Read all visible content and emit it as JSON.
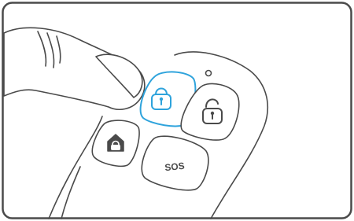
{
  "illustration": {
    "frame_color": "#4a4a4a",
    "line_color": "#4a4a4a",
    "highlight_color": "#2ea3dc",
    "buttons": [
      {
        "name": "lock-button",
        "icon": "lock-closed-icon",
        "pressed": true
      },
      {
        "name": "unlock-button",
        "icon": "lock-open-icon",
        "pressed": false
      },
      {
        "name": "home-arm-button",
        "icon": "home-lock-icon",
        "pressed": false
      },
      {
        "name": "sos-button",
        "label": "SOS",
        "pressed": false
      }
    ]
  }
}
